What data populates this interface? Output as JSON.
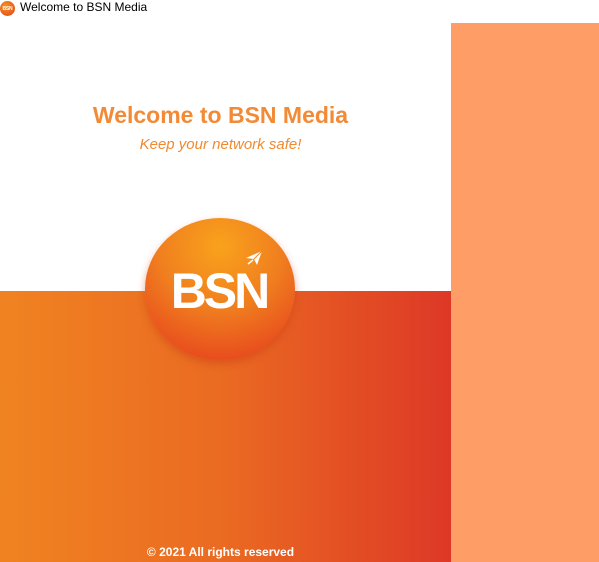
{
  "window": {
    "title": "Welcome to BSN Media",
    "icon": "bsn-logo-icon",
    "icon_text": "BSN"
  },
  "main": {
    "heading": "Welcome to BSN Media",
    "subheading": "Keep your network safe!",
    "logo_text": "BSN",
    "logo_icon": "paper-plane-icon",
    "footer": "©  2021 All rights reserved"
  },
  "colors": {
    "accent": "#f28a36",
    "right_panel": "#ff9d66",
    "gradient_start": "#f08321",
    "gradient_end": "#dd3826",
    "text_on_accent": "#ffffff"
  }
}
